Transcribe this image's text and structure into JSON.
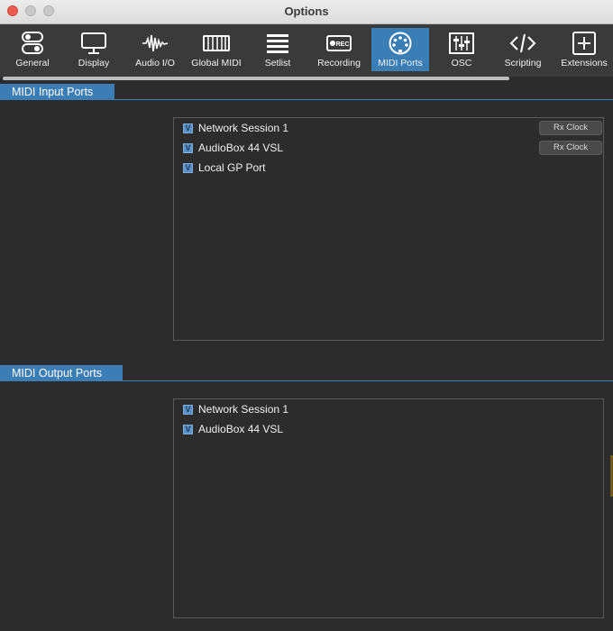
{
  "window": {
    "title": "Options"
  },
  "toolbar": {
    "items": [
      {
        "label": "General",
        "icon": "toggles-icon"
      },
      {
        "label": "Display",
        "icon": "monitor-icon"
      },
      {
        "label": "Audio I/O",
        "icon": "waveform-icon"
      },
      {
        "label": "Global MIDI",
        "icon": "keyboard-icon"
      },
      {
        "label": "Setlist",
        "icon": "list-icon"
      },
      {
        "label": "Recording",
        "icon": "rec-icon"
      },
      {
        "label": "MIDI Ports",
        "icon": "midi-din-icon",
        "active": true
      },
      {
        "label": "OSC",
        "icon": "sliders-icon"
      },
      {
        "label": "Scripting",
        "icon": "code-icon"
      },
      {
        "label": "Extensions",
        "icon": "plus-box-icon"
      }
    ],
    "rec_badge": "REC"
  },
  "midi_input": {
    "heading": "MIDI Input Ports",
    "ports": [
      {
        "name": "Network Session 1",
        "checked": true,
        "button": "Rx Clock"
      },
      {
        "name": "AudioBox 44 VSL",
        "checked": true,
        "button": "Rx Clock"
      },
      {
        "name": "Local GP Port",
        "checked": true
      }
    ]
  },
  "midi_output": {
    "heading": "MIDI Output Ports",
    "ports": [
      {
        "name": "Network Session 1",
        "checked": true
      },
      {
        "name": "AudioBox 44 VSL",
        "checked": true
      }
    ]
  },
  "checkbox_glyph": "V",
  "colors": {
    "accent": "#3b7db5",
    "checkbox": "#5b92c9",
    "background": "#2c2c2c",
    "close": "#ee5a52"
  }
}
